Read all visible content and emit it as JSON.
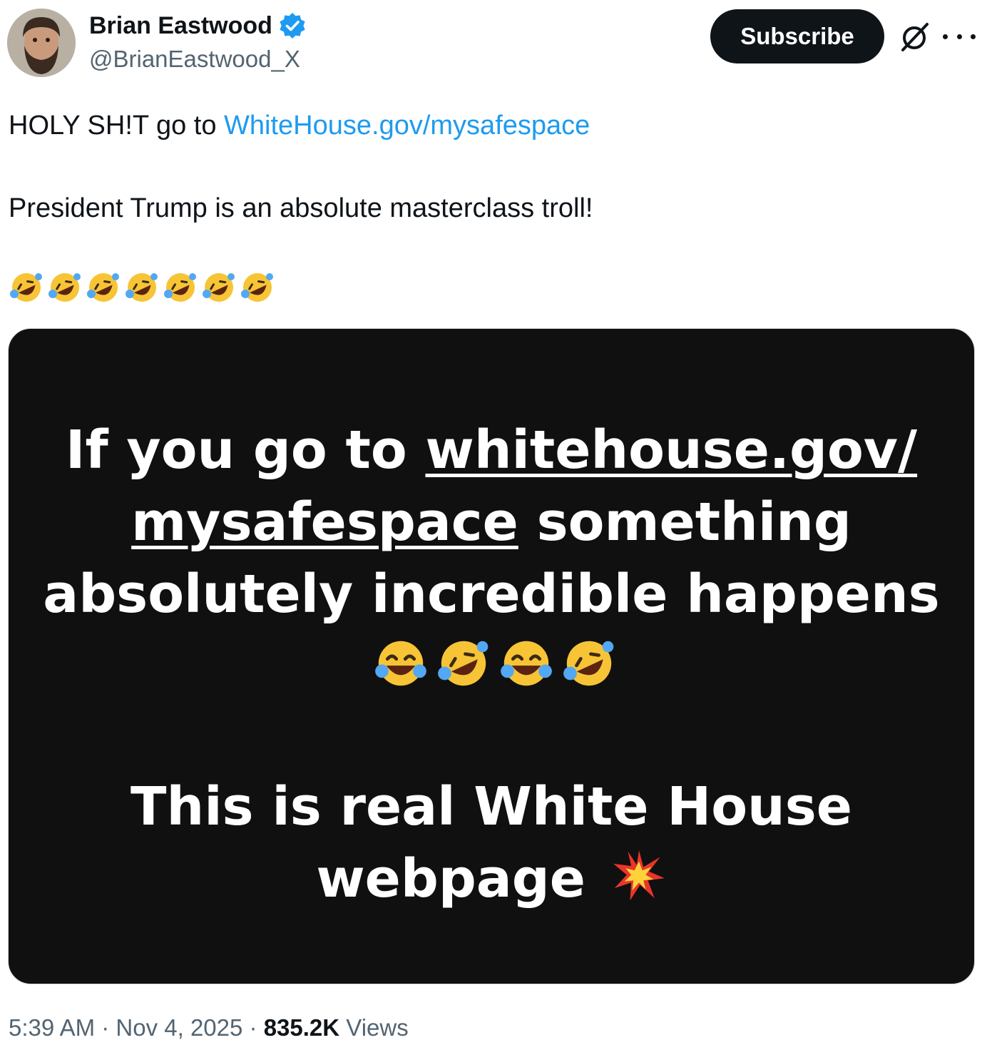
{
  "author": {
    "display_name": "Brian Eastwood",
    "handle": "@BrianEastwood_X",
    "verified": true,
    "verified_color": "#1d9bf0"
  },
  "actions": {
    "subscribe_label": "Subscribe",
    "grok_icon": "grok-icon",
    "more_icon": "more-icon"
  },
  "tweet": {
    "line1_prefix": "HOLY SH!T go to ",
    "line1_link": "WhiteHouse.gov/mysafespace",
    "line2": "President Trump is an absolute masterclass troll!",
    "emoji_line": "🤣🤣🤣🤣🤣🤣🤣",
    "link_color": "#1d9bf0"
  },
  "media": {
    "text_a1": "If you go to ",
    "url_part1": "whitehouse.gov/",
    "url_part2": "mysafespace",
    "text_a2": " something absolutely incredible happens",
    "emojis_a": "😂🤣😂🤣",
    "text_b": "This is real White House webpage",
    "emoji_b": "💥",
    "background": "#101010"
  },
  "footer": {
    "time": "5:39 AM",
    "date": "Nov 4, 2025",
    "separator": " · ",
    "views_count": "835.2K",
    "views_label": "Views"
  }
}
